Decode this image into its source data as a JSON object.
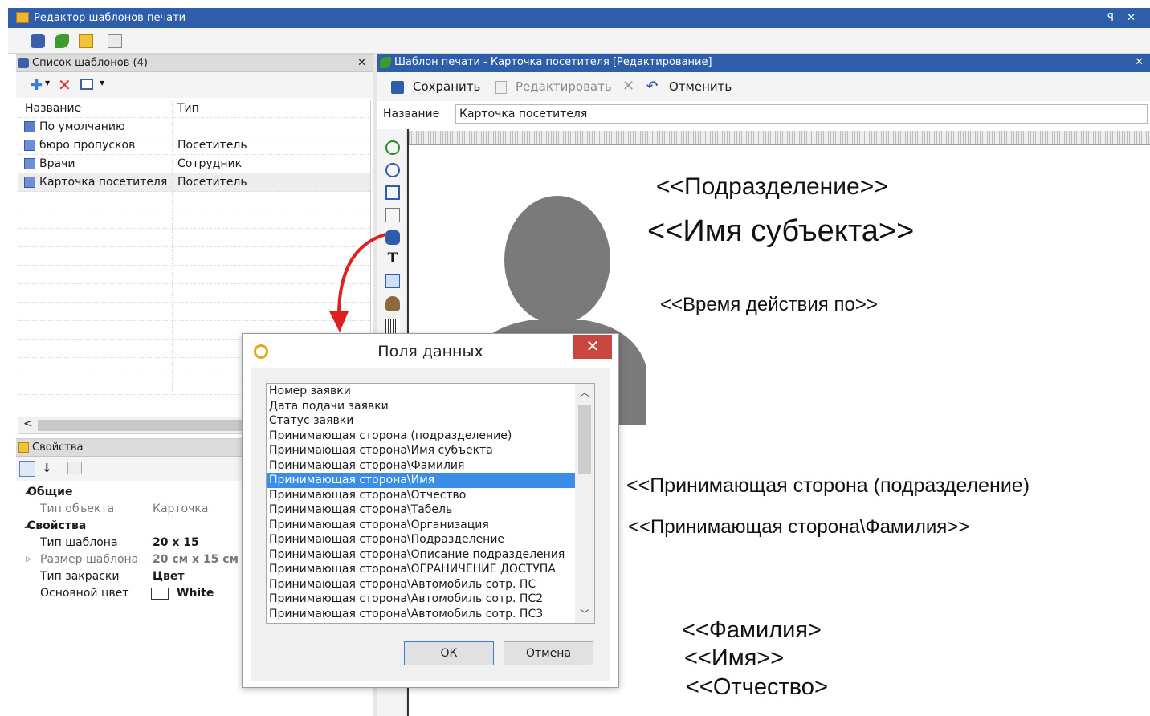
{
  "window": {
    "title": "Редактор шаблонов печати",
    "controls": "ꟼ ✕"
  },
  "templates_panel": {
    "title": "Список шаблонов (4)",
    "columns": [
      "Название",
      "Тип"
    ],
    "rows": [
      {
        "name": "По умолчанию",
        "type": ""
      },
      {
        "name": "бюро пропусков",
        "type": "Посетитель"
      },
      {
        "name": "Врачи",
        "type": "Сотрудник"
      },
      {
        "name": "Карточка посетителя",
        "type": "Посетитель"
      }
    ],
    "scroll_left": "<"
  },
  "properties_panel": {
    "title": "Свойства",
    "groups": [
      {
        "label": "Общие",
        "items": [
          {
            "key": "Тип объекта",
            "value": "Карточка"
          }
        ]
      },
      {
        "label": "Свойства",
        "items": [
          {
            "key": "Тип шаблона",
            "value": "20 x 15"
          },
          {
            "key": "Размер шаблона",
            "value": "20 см x 15 см"
          },
          {
            "key": "Тип закраски",
            "value": "Цвет"
          },
          {
            "key": "Основной цвет",
            "value": "White"
          }
        ]
      }
    ]
  },
  "editor": {
    "title": "Шаблон печати - Карточка посетителя [Редактирование]",
    "toolbar": {
      "save": "Сохранить",
      "edit": "Редактировать",
      "cancel": "Отменить"
    },
    "name_label": "Название",
    "name_value": "Карточка посетителя",
    "text_tool_glyph": "T"
  },
  "canvas": {
    "fields": {
      "division": "<<Подразделение>>",
      "subject": "<<Имя субъекта>>",
      "valid_until": "<<Время действия по>>",
      "host_division": "<<Принимающая сторона (подразделение)",
      "host_lastname": "<<Принимающая сторона\\Фамилия>>",
      "lastname": "<<Фамилия>",
      "firstname": "<<Имя>>",
      "patronymic": "<<Отчество>"
    }
  },
  "dialog": {
    "title": "Поля данных",
    "close": "✕",
    "items": [
      "Номер заявки",
      "Дата подачи заявки",
      "Статус заявки",
      "Принимающая сторона (подразделение)",
      "Принимающая сторона\\Имя субъекта",
      "Принимающая сторона\\Фамилия",
      "Принимающая сторона\\Имя",
      "Принимающая сторона\\Отчество",
      "Принимающая сторона\\Табель",
      "Принимающая сторона\\Организация",
      "Принимающая сторона\\Подразделение",
      "Принимающая сторона\\Описание подразделения",
      "Принимающая сторона\\ОГРАНИЧЕНИЕ ДОСТУПА",
      "Принимающая сторона\\Автомобиль сотр. ПС",
      "Принимающая сторона\\Автомобиль сотр. ПС2",
      "Принимающая сторона\\Автомобиль сотр. ПС3"
    ],
    "selected_index": 6,
    "ok": "ОК",
    "cancel": "Отмена"
  },
  "colors": {
    "title_bar": "#2e5eaa",
    "selection": "#3a8ee6",
    "dialog_close": "#c9473f",
    "arrow": "#e02020"
  }
}
